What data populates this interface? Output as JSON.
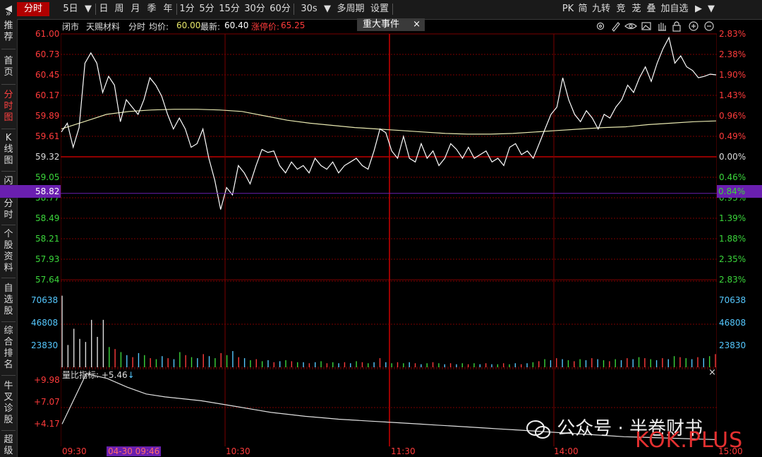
{
  "toolbar": {
    "left_arrow": "◀",
    "tabs": [
      "分时",
      "5日",
      "日",
      "周",
      "月",
      "季",
      "年",
      "1分",
      "5分",
      "15分",
      "30分",
      "60分",
      "30s",
      "多周期",
      "设置"
    ],
    "right_items": [
      "PK",
      "简",
      "九转",
      "竞",
      "茏",
      "叠",
      "加自选"
    ]
  },
  "sidebar": {
    "top_glyph": "»",
    "items": [
      "推荐",
      "首页",
      "分时图",
      "K线图",
      "闪电分时",
      "个股资料",
      "自选股",
      "综合排名",
      "牛叉诊股",
      "超级"
    ]
  },
  "info": {
    "status": "闭市",
    "name": "天赐材料",
    "mode": "分时",
    "avg_label": "均价:",
    "avg_value": "60.00",
    "latest_label": "最新:",
    "latest_value": "60.40",
    "limit_label": "涨停价:",
    "limit_value": "65.25",
    "event_tag": "重大事件",
    "event_close": "×"
  },
  "price_axis": {
    "left": [
      "61.00",
      "60.73",
      "60.45",
      "60.17",
      "59.89",
      "59.61",
      "59.32",
      "59.05",
      "58.77",
      "58.49",
      "58.21",
      "57.93",
      "57.64"
    ],
    "right": [
      "2.83%",
      "2.38%",
      "1.90%",
      "1.43%",
      "0.96%",
      "0.49%",
      "0.00%",
      "0.46%",
      "0.93%",
      "1.39%",
      "1.88%",
      "2.35%",
      "2.83%"
    ],
    "cursor_price": "58.82",
    "cursor_pct": "0.84%"
  },
  "volume_axis": [
    "70638",
    "46808",
    "23830"
  ],
  "indicator": {
    "title": "量比指标: +5.46",
    "arrow": "↓",
    "axis": [
      "+9.98",
      "+7.07",
      "+4.17"
    ]
  },
  "time_axis": [
    "09:30",
    "04-30 09:46",
    "10:30",
    "11:30",
    "14:00",
    "15:00"
  ],
  "watermark": "公众号 · 半卷财书",
  "watermark_brand": "KOK.PLUS",
  "colors": {
    "up": "#ff3b3b",
    "down": "#3bd63b",
    "volume": "#55c8ff",
    "grid": "#7a0000",
    "price_line": "#ffffff",
    "avg_line": "#e8e8b0",
    "cursor_bg": "#6a1fb0"
  },
  "chart_data": {
    "type": "line",
    "series": [
      {
        "values": [
          59.66,
          59.78,
          59.45,
          59.72,
          60.6,
          60.74,
          60.6,
          60.2,
          60.42,
          60.3,
          59.8,
          60.1,
          60.0,
          59.9,
          60.1,
          60.4,
          60.3,
          60.15,
          59.9,
          59.7,
          59.85,
          59.7,
          59.45,
          59.5,
          59.7,
          59.3,
          59.0,
          58.6,
          58.9,
          58.8,
          59.2,
          59.1,
          58.95,
          59.2,
          59.42,
          59.38,
          59.4,
          59.2,
          59.1,
          59.25,
          59.15,
          59.2,
          59.1,
          59.3,
          59.2,
          59.15,
          59.25,
          59.1,
          59.2,
          59.25,
          59.3,
          59.2,
          59.15,
          59.4,
          59.7,
          59.65,
          59.4,
          59.3,
          59.6,
          59.3,
          59.25,
          59.5,
          59.3,
          59.4,
          59.2,
          59.3,
          59.5,
          59.42,
          59.3,
          59.45,
          59.3,
          59.35,
          59.4,
          59.25,
          59.3,
          59.2,
          59.45,
          59.5,
          59.35,
          59.4,
          59.3,
          59.5,
          59.7,
          59.9,
          60.0,
          60.4,
          60.1,
          59.9,
          59.8,
          59.95,
          59.85,
          59.7,
          59.9,
          59.85,
          60.0,
          60.1,
          60.3,
          60.2,
          60.4,
          60.55,
          60.35,
          60.6,
          60.8,
          60.95,
          60.6,
          60.7,
          60.55,
          60.5,
          60.4,
          60.42,
          60.45,
          60.44
        ]
      },
      {
        "values": [
          59.7,
          59.8,
          59.9,
          59.94,
          59.96,
          59.97,
          59.97,
          59.96,
          59.94,
          59.88,
          59.82,
          59.78,
          59.75,
          59.72,
          59.7,
          59.68,
          59.66,
          59.64,
          59.63,
          59.63,
          59.64,
          59.66,
          59.68,
          59.7,
          59.72,
          59.73,
          59.76,
          59.78,
          59.8,
          59.81
        ]
      }
    ],
    "volume_values": [
      70638,
      22000,
      38000,
      28000,
      25000,
      46808,
      30000,
      46808,
      20000,
      18000,
      15000,
      12000,
      10000,
      14000,
      12000,
      9000,
      8000,
      11000,
      9000,
      8000,
      15000,
      12000,
      10000,
      9000,
      13000,
      11000,
      9000,
      14000,
      12000,
      16000,
      10000,
      9000,
      7000,
      8000,
      6000,
      7000,
      5000,
      6000,
      7000,
      6000,
      5000,
      5000,
      4000,
      5000,
      6000,
      4000,
      5000,
      4000,
      5000,
      4000,
      6000,
      5000,
      4000,
      5000,
      9000,
      5000,
      4000,
      5000,
      4000,
      5000,
      4000,
      3000,
      4000,
      5000,
      4000,
      3000,
      4000,
      3000,
      4000,
      3000,
      4000,
      3000,
      4000,
      3000,
      3000,
      4000,
      3000,
      4000,
      3000,
      4000,
      5000,
      6000,
      8000,
      7000,
      9000,
      8000,
      7000,
      6000,
      8000,
      7000,
      9000,
      8000,
      7000,
      6000,
      8000,
      7000,
      9000,
      8000,
      10000,
      9000,
      8000,
      7000,
      9000,
      8000,
      11000,
      10000,
      9000,
      8000,
      10000,
      9000,
      11000,
      13000
    ],
    "volume_ylim": [
      0,
      85000
    ],
    "indicator_values": [
      4.8,
      9.98,
      9.5,
      8.6,
      7.9,
      7.6,
      7.4,
      7.2,
      6.9,
      6.6,
      6.3,
      6.0,
      5.8,
      5.6,
      5.45,
      5.3,
      5.2,
      5.1,
      5.0,
      4.9,
      4.8,
      4.7,
      4.6,
      4.5,
      4.4,
      4.3,
      4.2,
      4.1,
      4.0,
      3.9,
      3.8,
      3.7,
      3.6,
      3.5,
      3.45,
      3.4,
      3.35,
      3.3,
      3.25,
      3.2
    ],
    "indicator_ylim": [
      2.5,
      10.5
    ],
    "ylim": [
      57.64,
      61.0
    ],
    "prev_close": 59.32,
    "grid": true
  }
}
